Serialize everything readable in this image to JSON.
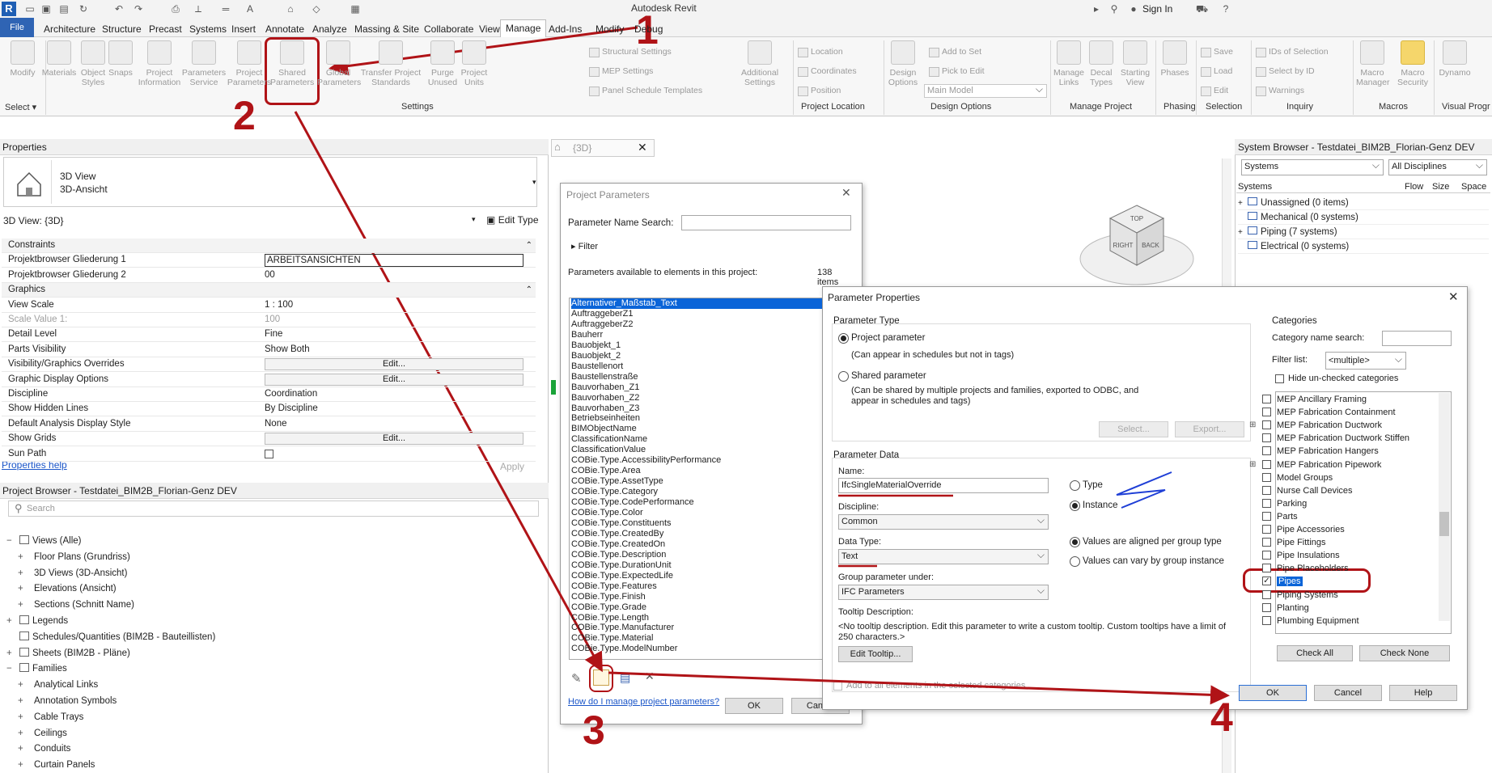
{
  "app": {
    "title": "Autodesk Revit",
    "logo": "R"
  },
  "account": {
    "sign_in": "Sign In"
  },
  "menu": {
    "file": "File",
    "tabs": [
      "Architecture",
      "Structure",
      "Precast",
      "Systems",
      "Insert",
      "Annotate",
      "Analyze",
      "Massing & Site",
      "Collaborate",
      "View",
      "Manage",
      "Add-Ins",
      "Modify",
      "Debug"
    ]
  },
  "ribbon": {
    "select": {
      "modify": "Modify",
      "label": "Select"
    },
    "settings": {
      "big": [
        "Materials",
        "Object Styles",
        "Snaps",
        "Project Information",
        "Parameters Service",
        "Project Parameters",
        "Shared Parameters",
        "Global Parameters",
        "Transfer Project Standards",
        "Purge Unused",
        "Project Units"
      ],
      "small": [
        "Structural Settings",
        "MEP Settings",
        "Panel Schedule Templates"
      ],
      "additional": "Additional Settings",
      "label": "Settings"
    },
    "project_location": {
      "items": [
        "Location",
        "Coordinates",
        "Position"
      ],
      "label": "Project Location"
    },
    "design_options": {
      "big": "Design Options",
      "main_model": "Main Model",
      "small": [
        "Add to Set",
        "Pick to Edit"
      ],
      "label": "Design Options"
    },
    "manage_project": {
      "big": [
        "Manage Links",
        "Decal Types",
        "Starting View"
      ],
      "label": "Manage Project"
    },
    "phasing": {
      "big": "Phases",
      "label": "Phasing"
    },
    "selection": {
      "small": [
        "Save",
        "Load",
        "Edit"
      ],
      "label": "Selection"
    },
    "inquiry": {
      "small": [
        "IDs of Selection",
        "Select by ID",
        "Warnings"
      ],
      "label": "Inquiry"
    },
    "macros": {
      "big": [
        "Macro Manager",
        "Macro Security"
      ],
      "label": "Macros"
    },
    "visual_programming": {
      "big": "Dynamo",
      "label": "Visual Progr"
    }
  },
  "properties": {
    "header": "Properties",
    "type_line1": "3D View",
    "type_line2": "3D-Ansicht",
    "instance_label": "3D View: {3D}",
    "edit_type": "Edit Type",
    "rows": [
      {
        "k": "Constraints",
        "group": true
      },
      {
        "k": "Projektbrowser Gliederung 1",
        "v": "ARBEITSANSICHTEN"
      },
      {
        "k": "Projektbrowser Gliederung 2",
        "v": "00"
      },
      {
        "k": "Graphics",
        "group": true
      },
      {
        "k": "View Scale",
        "v": "1 : 100"
      },
      {
        "k": "Scale Value    1:",
        "v": "100",
        "grey": true
      },
      {
        "k": "Detail Level",
        "v": "Fine"
      },
      {
        "k": "Parts Visibility",
        "v": "Show Both"
      },
      {
        "k": "Visibility/Graphics Overrides",
        "btn": "Edit..."
      },
      {
        "k": "Graphic Display Options",
        "btn": "Edit..."
      },
      {
        "k": "Discipline",
        "v": "Coordination"
      },
      {
        "k": "Show Hidden Lines",
        "v": "By Discipline"
      },
      {
        "k": "Default Analysis Display Style",
        "v": "None"
      },
      {
        "k": "Show Grids",
        "btn": "Edit..."
      },
      {
        "k": "Sun Path",
        "v": ""
      }
    ],
    "help": "Properties help",
    "apply": "Apply"
  },
  "project_browser": {
    "header": "Project Browser - Testdatei_BIM2B_Florian-Genz DEV",
    "search": "Search",
    "items": [
      {
        "t": "Views (Alle)",
        "lvl": 0,
        "exp": "−"
      },
      {
        "t": "Floor Plans (Grundriss)",
        "lvl": 1,
        "exp": "+"
      },
      {
        "t": "3D Views (3D-Ansicht)",
        "lvl": 1,
        "exp": "+"
      },
      {
        "t": "Elevations (Ansicht)",
        "lvl": 1,
        "exp": "+"
      },
      {
        "t": "Sections (Schnitt Name)",
        "lvl": 1,
        "exp": "+"
      },
      {
        "t": "Legends",
        "lvl": 0,
        "exp": "+"
      },
      {
        "t": "Schedules/Quantities (BIM2B - Bauteillisten)",
        "lvl": 0,
        "exp": ""
      },
      {
        "t": "Sheets (BIM2B - Pläne)",
        "lvl": 0,
        "exp": "+"
      },
      {
        "t": "Families",
        "lvl": 0,
        "exp": "−"
      },
      {
        "t": "Analytical Links",
        "lvl": 1,
        "exp": "+"
      },
      {
        "t": "Annotation Symbols",
        "lvl": 1,
        "exp": "+"
      },
      {
        "t": "Cable Trays",
        "lvl": 1,
        "exp": "+"
      },
      {
        "t": "Ceilings",
        "lvl": 1,
        "exp": "+"
      },
      {
        "t": "Conduits",
        "lvl": 1,
        "exp": "+"
      },
      {
        "t": "Curtain Panels",
        "lvl": 1,
        "exp": "+"
      }
    ]
  },
  "view_tab": {
    "label": "{3D}"
  },
  "viewcube": {
    "top": "TOP",
    "right": "RIGHT",
    "back": "BACK"
  },
  "system_browser": {
    "header": "System Browser - Testdatei_BIM2B_Florian-Genz DEV",
    "systems_select": "Systems",
    "disciplines_select": "All Disciplines",
    "columns": [
      "Systems",
      "Flow",
      "Size",
      "Space"
    ],
    "rows": [
      {
        "t": "Unassigned (0 items)",
        "exp": "+"
      },
      {
        "t": "Mechanical (0 systems)",
        "exp": ""
      },
      {
        "t": "Piping (7 systems)",
        "exp": "+"
      },
      {
        "t": "Electrical (0 systems)",
        "exp": ""
      }
    ]
  },
  "project_parameters": {
    "title": "Project Parameters",
    "search_label": "Parameter Name Search:",
    "filter": "Filter",
    "available_label": "Parameters available to elements in this project:",
    "count": "138",
    "count_unit": "items",
    "items": [
      "Alternativer_Maßstab_Text",
      "AuftraggeberZ1",
      "AuftraggeberZ2",
      "Bauherr",
      "Bauobjekt_1",
      "Bauobjekt_2",
      "Baustellenort",
      "Baustellenstraße",
      "Bauvorhaben_Z1",
      "Bauvorhaben_Z2",
      "Bauvorhaben_Z3",
      "Betriebseinheiten",
      "BIMObjectName",
      "ClassificationName",
      "ClassificationValue",
      "COBie.Type.AccessibilityPerformance",
      "COBie.Type.Area",
      "COBie.Type.AssetType",
      "COBie.Type.Category",
      "COBie.Type.CodePerformance",
      "COBie.Type.Color",
      "COBie.Type.Constituents",
      "COBie.Type.CreatedBy",
      "COBie.Type.CreatedOn",
      "COBie.Type.Description",
      "COBie.Type.DurationUnit",
      "COBie.Type.ExpectedLife",
      "COBie.Type.Features",
      "COBie.Type.Finish",
      "COBie.Type.Grade",
      "COBie.Type.Length",
      "COBie.Type.Manufacturer",
      "COBie.Type.Material",
      "COBie.Type.ModelNumber"
    ],
    "help_link": "How do I manage project parameters?",
    "ok": "OK",
    "cancel": "Cancel"
  },
  "parameter_properties": {
    "title": "Parameter Properties",
    "param_type_label": "Parameter Type",
    "project_param": "Project parameter",
    "project_param_desc": "(Can appear in schedules but not in tags)",
    "shared_param": "Shared parameter",
    "shared_param_desc": "(Can be shared by multiple projects and families, exported to ODBC, and appear in schedules and tags)",
    "select_btn": "Select...",
    "export_btn": "Export...",
    "param_data_label": "Parameter Data",
    "name_label": "Name:",
    "name_value": "IfcSingleMaterialOverride",
    "type_radio": "Type",
    "instance_radio": "Instance",
    "discipline_label": "Discipline:",
    "discipline_value": "Common",
    "data_type_label": "Data Type:",
    "data_type_value": "Text",
    "group_label": "Group parameter under:",
    "group_value": "IFC Parameters",
    "aligned": "Values are aligned per group type",
    "vary": "Values can vary by group instance",
    "tooltip_label": "Tooltip Description:",
    "tooltip_text": "<No tooltip description. Edit this parameter to write a custom tooltip. Custom tooltips have a limit of 250 characters.>",
    "edit_tooltip": "Edit Tooltip...",
    "add_all": "Add to all elements in the selected categories",
    "categories_label": "Categories",
    "cat_search_label": "Category name search:",
    "filter_list_label": "Filter list:",
    "filter_list_value": "<multiple>",
    "hide_unchecked": "Hide un-checked categories",
    "categories": [
      {
        "t": "MEP Ancillary Framing",
        "exp": "",
        "checked": false
      },
      {
        "t": "MEP Fabrication Containment",
        "exp": "",
        "checked": false
      },
      {
        "t": "MEP Fabrication Ductwork",
        "exp": "+",
        "checked": false
      },
      {
        "t": "MEP Fabrication Ductwork Stiffen",
        "exp": "",
        "checked": false
      },
      {
        "t": "MEP Fabrication Hangers",
        "exp": "",
        "checked": false
      },
      {
        "t": "MEP Fabrication Pipework",
        "exp": "+",
        "checked": false
      },
      {
        "t": "Model Groups",
        "exp": "",
        "checked": false
      },
      {
        "t": "Nurse Call Devices",
        "exp": "",
        "checked": false
      },
      {
        "t": "Parking",
        "exp": "",
        "checked": false
      },
      {
        "t": "Parts",
        "exp": "",
        "checked": false
      },
      {
        "t": "Pipe Accessories",
        "exp": "",
        "checked": false
      },
      {
        "t": "Pipe Fittings",
        "exp": "",
        "checked": false
      },
      {
        "t": "Pipe Insulations",
        "exp": "",
        "checked": false
      },
      {
        "t": "Pipe Placeholders",
        "exp": "",
        "checked": false
      },
      {
        "t": "Pipes",
        "exp": "",
        "checked": true
      },
      {
        "t": "Piping Systems",
        "exp": "",
        "checked": false
      },
      {
        "t": "Planting",
        "exp": "",
        "checked": false
      },
      {
        "t": "Plumbing Equipment",
        "exp": "",
        "checked": false
      }
    ],
    "check_all": "Check All",
    "check_none": "Check None",
    "ok": "OK",
    "cancel": "Cancel",
    "help": "Help"
  },
  "annotations": {
    "n1": "1",
    "n2": "2",
    "n3": "3",
    "n4": "4",
    "color": "#b01317",
    "blue": "#1f3fd6"
  }
}
